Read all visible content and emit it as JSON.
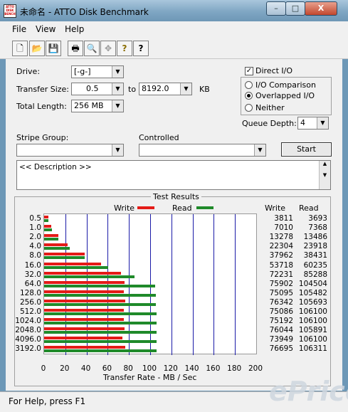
{
  "window": {
    "title": "未命名 - ATTO Disk Benchmark",
    "app_icon_text": "ATTO DISK BENCH",
    "minimize": "–",
    "maximize": "□",
    "close": "X"
  },
  "menu": [
    "File",
    "View",
    "Help"
  ],
  "toolbar": {
    "icons": [
      "new-file-icon",
      "open-folder-icon",
      "save-icon",
      "print-icon",
      "print-preview-icon",
      "move-icon",
      "help-icon",
      "context-help-icon"
    ],
    "glyphs": [
      "🗋",
      "📂",
      "💾",
      "🖶",
      "🔍",
      "✥",
      "?",
      "?"
    ]
  },
  "settings": {
    "drive_label": "Drive:",
    "drive_value": "[-g-]",
    "transfer_size_label": "Transfer Size:",
    "transfer_from": "0.5",
    "transfer_to_word": "to",
    "transfer_to": "8192.0",
    "transfer_unit": "KB",
    "total_length_label": "Total Length:",
    "total_length_value": "256 MB",
    "direct_io_label": "Direct I/O",
    "direct_io_checked": true,
    "io_comparison_label": "I/O Comparison",
    "overlapped_io_label": "Overlapped I/O",
    "neither_label": "Neither",
    "selected_mode": "Overlapped I/O",
    "queue_depth_label": "Queue Depth:",
    "queue_depth_value": "4",
    "stripe_group_label": "Stripe Group:",
    "controlled_label": "Controlled",
    "start_label": "Start",
    "description_text": "<< Description >>"
  },
  "results": {
    "group_title": "Test Results",
    "legend_write": "Write",
    "legend_read": "Read",
    "col_write": "Write",
    "col_read": "Read",
    "xlabel": "Transfer Rate - MB / Sec"
  },
  "chart_data": {
    "type": "bar",
    "orientation": "horizontal",
    "title": "Test Results",
    "xlabel": "Transfer Rate - MB / Sec",
    "xlim": [
      0,
      200
    ],
    "xticks": [
      "0",
      "20",
      "40",
      "60",
      "80",
      "100",
      "120",
      "140",
      "160",
      "180",
      "200"
    ],
    "categories": [
      "0.5",
      "1.0",
      "2.0",
      "4.0",
      "8.0",
      "16.0",
      "32.0",
      "64.0",
      "128.0",
      "256.0",
      "512.0",
      "1024.0",
      "2048.0",
      "4096.0",
      "3192.0"
    ],
    "series": [
      {
        "name": "Write",
        "color": "#e41b17",
        "values": [
          3811,
          7010,
          13278,
          22304,
          37962,
          53718,
          72231,
          75902,
          75095,
          76342,
          75086,
          75192,
          76044,
          73949,
          76695
        ],
        "labels": [
          "3811",
          "7010",
          "13278",
          "22304",
          "37962",
          "53718",
          "72231",
          "75902",
          "75095",
          "76342",
          "75086",
          "75192",
          "76044",
          "73949",
          "76695"
        ]
      },
      {
        "name": "Read",
        "color": "#1f8a2a",
        "values": [
          3693,
          7368,
          13486,
          23918,
          38431,
          60235,
          85288,
          104504,
          105482,
          105693,
          106100,
          106100,
          105891,
          106100,
          106311
        ],
        "labels": [
          "3693",
          "7368",
          "13486",
          "23918",
          "38431",
          "60235",
          "85288",
          "104504",
          "105482",
          "105693",
          "106100",
          "106100",
          "105891",
          "106100",
          "106311"
        ]
      }
    ]
  },
  "status": {
    "text": "For Help, press F1"
  },
  "watermark": "ePrice"
}
